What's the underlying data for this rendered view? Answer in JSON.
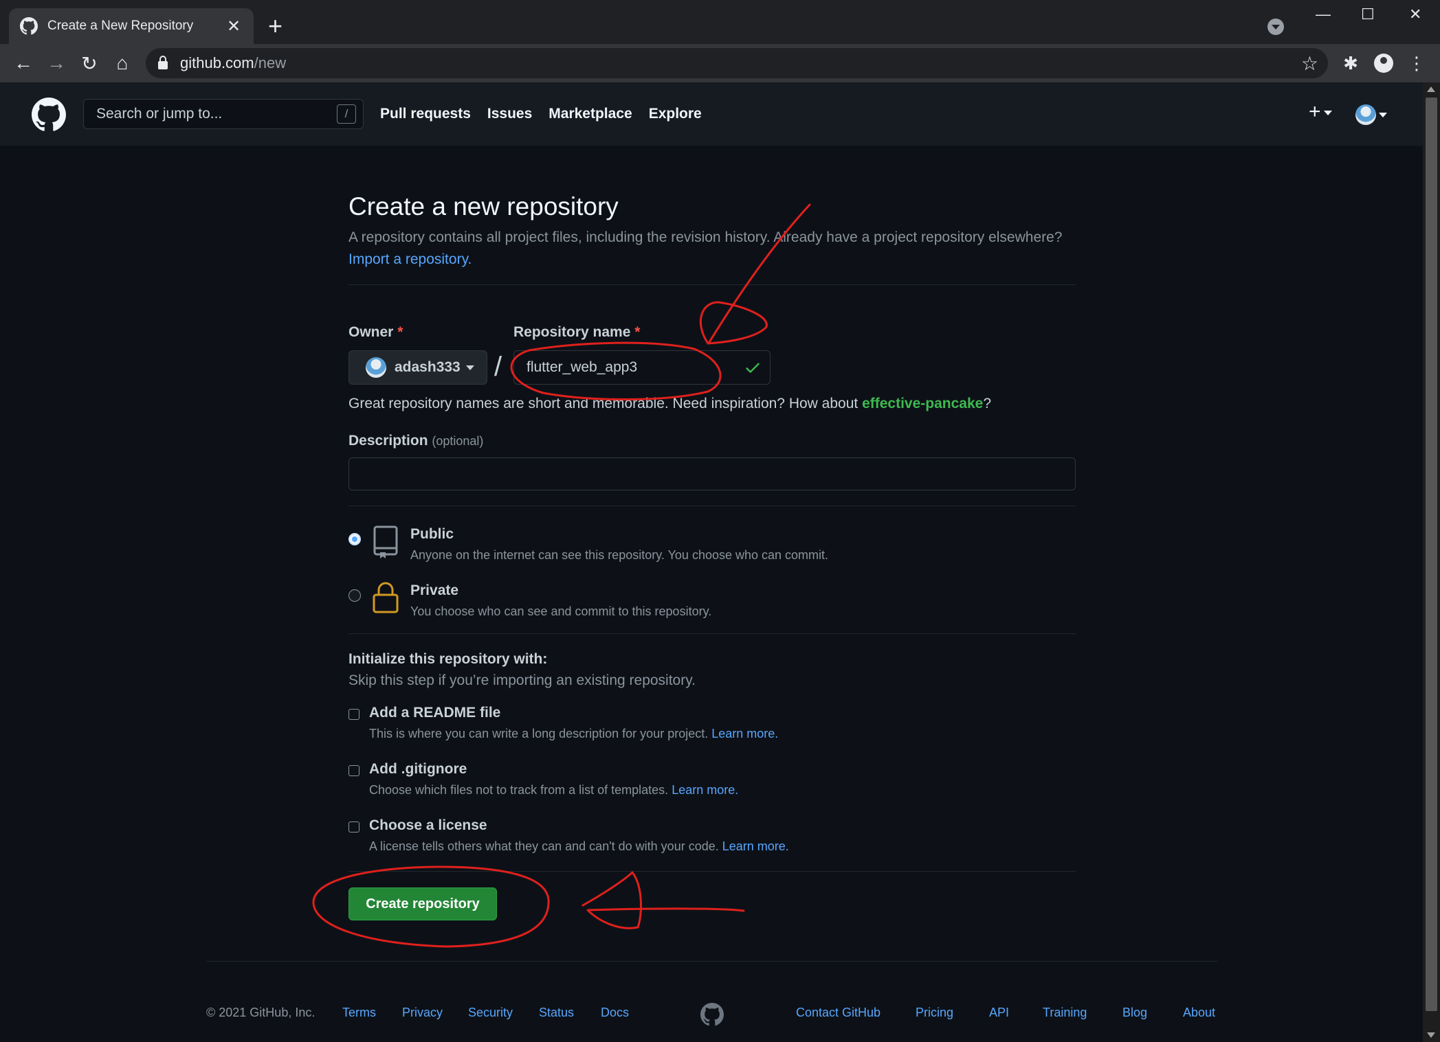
{
  "browser": {
    "tab_title": "Create a New Repository",
    "url_host": "github.com",
    "url_path": "/new"
  },
  "header": {
    "search_placeholder": "Search or jump to...",
    "search_shortcut": "/",
    "nav": [
      "Pull requests",
      "Issues",
      "Marketplace",
      "Explore"
    ]
  },
  "form": {
    "title": "Create a new repository",
    "subtitle": "A repository contains all project files, including the revision history. Already have a project repository elsewhere?",
    "import_link": "Import a repository.",
    "owner_label": "Owner",
    "owner_value": "adash333",
    "repo_label": "Repository name",
    "required_mark": "*",
    "repo_value": "flutter_web_app3",
    "name_hint": "Great repository names are short and memorable. Need inspiration? How about ",
    "name_suggestion": "effective-pancake",
    "name_hint_end": "?",
    "description_label": "Description",
    "description_optional": "(optional)",
    "visibility": {
      "public_title": "Public",
      "public_desc": "Anyone on the internet can see this repository. You choose who can commit.",
      "private_title": "Private",
      "private_desc": "You choose who can see and commit to this repository."
    },
    "init_title": "Initialize this repository with:",
    "init_subtitle": "Skip this step if you’re importing an existing repository.",
    "readme_title": "Add a README file",
    "readme_desc": "This is where you can write a long description for your project. ",
    "gitignore_title": "Add .gitignore",
    "gitignore_desc": "Choose which files not to track from a list of templates. ",
    "license_title": "Choose a license",
    "license_desc": "A license tells others what they can and can't do with your code. ",
    "learn_more": "Learn more.",
    "create_button": "Create repository"
  },
  "footer": {
    "copyright": "© 2021 GitHub, Inc.",
    "left_links": [
      "Terms",
      "Privacy",
      "Security",
      "Status",
      "Docs"
    ],
    "right_links": [
      "Contact GitHub",
      "Pricing",
      "API",
      "Training",
      "Blog",
      "About"
    ]
  },
  "colors": {
    "page_bg": "#0d1117",
    "header_bg": "#161b22",
    "link": "#58a6ff",
    "create_button": "#238636",
    "suggestion": "#3fb950",
    "annotation": "#e0201d"
  }
}
